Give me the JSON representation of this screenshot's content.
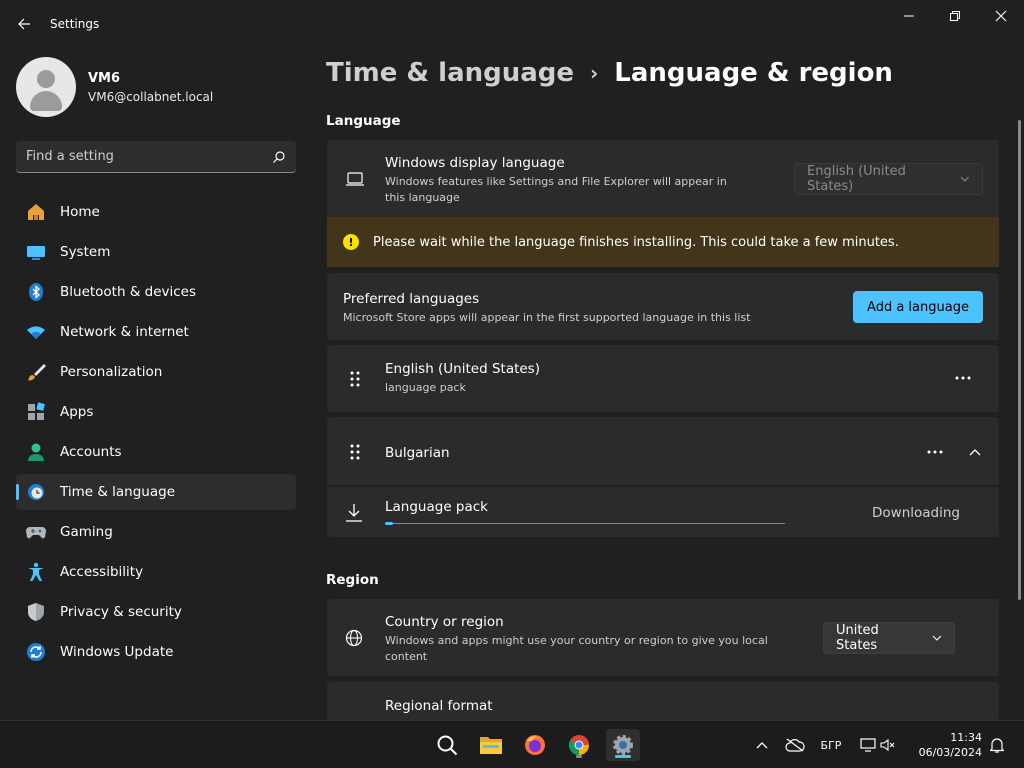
{
  "window": {
    "title": "Settings"
  },
  "profile": {
    "name": "VM6",
    "email": "VM6@collabnet.local"
  },
  "search": {
    "placeholder": "Find a setting"
  },
  "nav": {
    "items": [
      {
        "label": "Home",
        "icon": "home-icon"
      },
      {
        "label": "System",
        "icon": "system-icon"
      },
      {
        "label": "Bluetooth & devices",
        "icon": "bluetooth-icon"
      },
      {
        "label": "Network & internet",
        "icon": "wifi-icon"
      },
      {
        "label": "Personalization",
        "icon": "brush-icon"
      },
      {
        "label": "Apps",
        "icon": "apps-icon"
      },
      {
        "label": "Accounts",
        "icon": "accounts-icon"
      },
      {
        "label": "Time & language",
        "icon": "time-language-icon"
      },
      {
        "label": "Gaming",
        "icon": "gamepad-icon"
      },
      {
        "label": "Accessibility",
        "icon": "accessibility-icon"
      },
      {
        "label": "Privacy & security",
        "icon": "shield-icon"
      },
      {
        "label": "Windows Update",
        "icon": "update-icon"
      }
    ],
    "active_index": 7
  },
  "breadcrumb": {
    "parent": "Time & language",
    "separator": "›",
    "current": "Language & region"
  },
  "language_section": {
    "title": "Language",
    "display_language": {
      "title": "Windows display language",
      "description": "Windows features like Settings and File Explorer will appear in this language",
      "selected": "English (United States)"
    },
    "warning": {
      "text": "Please wait while the language finishes installing. This could take a few minutes."
    },
    "preferred": {
      "title": "Preferred languages",
      "description": "Microsoft Store apps will appear in the first supported language in this list",
      "add_button": "Add a language"
    },
    "languages": [
      {
        "name": "English (United States)",
        "sub": "language pack"
      },
      {
        "name": "Bulgarian",
        "sub": ""
      }
    ],
    "download": {
      "label": "Language pack",
      "status": "Downloading",
      "progress": 0.02
    }
  },
  "region_section": {
    "title": "Region",
    "country": {
      "title": "Country or region",
      "description": "Windows and apps might use your country or region to give you local content",
      "selected": "United States"
    },
    "format": {
      "title": "Regional format"
    }
  },
  "taskbar": {
    "apps": [
      "search-icon",
      "file-explorer-icon",
      "firefox-icon",
      "chrome-icon",
      "settings-icon"
    ],
    "language_indicator": "БГР",
    "time": "11:34",
    "date": "06/03/2024"
  },
  "colors": {
    "accent": "#4cc2ff",
    "warning_bg": "#433519",
    "warning_icon": "#fce100",
    "card_bg": "#2b2b2b",
    "window_bg": "#202020"
  }
}
